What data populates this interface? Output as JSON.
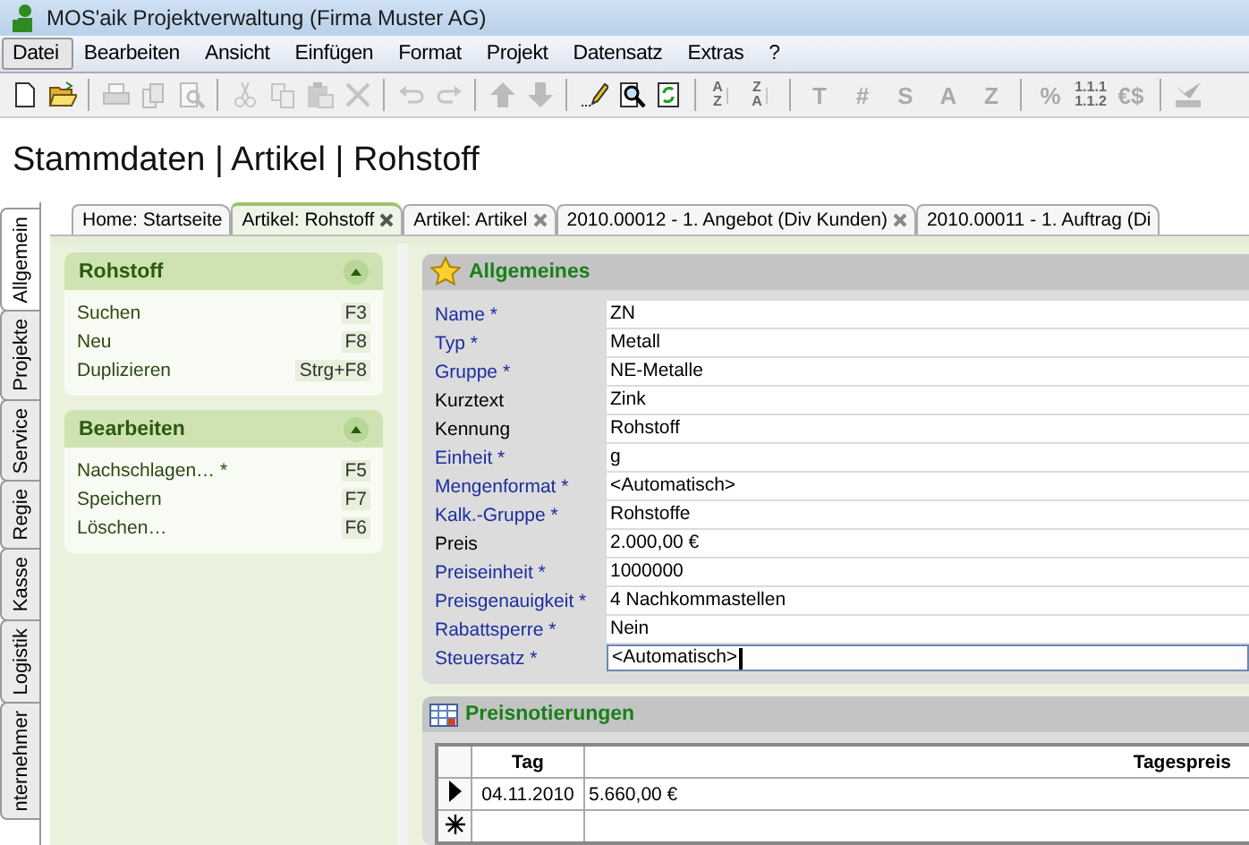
{
  "window": {
    "title": "MOS'aik Projektverwaltung (Firma Muster AG)"
  },
  "menu": [
    {
      "label": "Datei",
      "selected": true
    },
    {
      "label": "Bearbeiten",
      "selected": false
    },
    {
      "label": "Ansicht",
      "selected": false
    },
    {
      "label": "Einfügen",
      "selected": false
    },
    {
      "label": "Format",
      "selected": false
    },
    {
      "label": "Projekt",
      "selected": false
    },
    {
      "label": "Datensatz",
      "selected": false
    },
    {
      "label": "Extras",
      "selected": false
    },
    {
      "label": "?",
      "selected": false
    }
  ],
  "toolbar": [
    [
      {
        "kind": "icon",
        "disabled": false
      },
      {
        "kind": "icon",
        "disabled": false
      }
    ],
    [
      {
        "kind": "icon",
        "disabled": true
      },
      {
        "kind": "icon",
        "disabled": true
      },
      {
        "kind": "icon",
        "disabled": true
      }
    ],
    [
      {
        "kind": "icon",
        "disabled": true
      },
      {
        "kind": "icon",
        "disabled": true
      },
      {
        "kind": "icon",
        "disabled": true
      },
      {
        "kind": "icon",
        "disabled": true
      }
    ],
    [
      {
        "kind": "icon",
        "disabled": true
      },
      {
        "kind": "icon",
        "disabled": true
      }
    ],
    [
      {
        "kind": "icon",
        "disabled": true
      },
      {
        "kind": "icon",
        "disabled": true
      }
    ],
    [
      {
        "kind": "icon",
        "disabled": false
      },
      {
        "kind": "icon",
        "disabled": false
      },
      {
        "kind": "icon",
        "disabled": false
      }
    ],
    [
      {
        "kind": "sort",
        "lines": [
          "A",
          "Z"
        ],
        "disabled": true
      },
      {
        "kind": "sort",
        "lines": [
          "Z",
          "A"
        ],
        "disabled": true
      }
    ],
    [
      {
        "kind": "glyph",
        "label": "T",
        "disabled": true
      },
      {
        "kind": "glyph",
        "label": "#",
        "disabled": true
      },
      {
        "kind": "glyph",
        "label": "S",
        "disabled": true
      },
      {
        "kind": "glyph",
        "label": "A",
        "disabled": true
      },
      {
        "kind": "glyph",
        "label": "Z",
        "disabled": true
      }
    ],
    [
      {
        "kind": "glyph",
        "label": "%",
        "disabled": true
      },
      {
        "kind": "stack",
        "lines": [
          "1.1.1",
          "1.1.2"
        ],
        "disabled": true
      },
      {
        "kind": "glyph",
        "label": "€$",
        "disabled": true
      }
    ],
    [
      {
        "kind": "icon",
        "disabled": true
      }
    ]
  ],
  "heading": "Stammdaten | Artikel | Rohstoff",
  "side_tabs": [
    {
      "label": "Allgemein",
      "selected": true
    },
    {
      "label": "Projekte",
      "selected": false
    },
    {
      "label": "Service",
      "selected": false
    },
    {
      "label": "Regie",
      "selected": false
    },
    {
      "label": "Kasse",
      "selected": false
    },
    {
      "label": "Logistik",
      "selected": false
    },
    {
      "label": "nternehmer",
      "selected": false
    }
  ],
  "doc_tabs": [
    {
      "label": "Home: Startseite",
      "selected": false,
      "closable": false
    },
    {
      "label": "Artikel: Rohstoff",
      "selected": true,
      "closable": true
    },
    {
      "label": "Artikel: Artikel",
      "selected": false,
      "closable": true
    },
    {
      "label": "2010.00012 - 1. Angebot (Div Kunden)",
      "selected": false,
      "closable": true
    },
    {
      "label": "2010.00011 - 1. Auftrag (Di",
      "selected": false,
      "closable": false
    }
  ],
  "task_groups": [
    {
      "title": "Rohstoff",
      "expanded": true,
      "items": [
        {
          "label": "Suchen",
          "shortcut": "F3"
        },
        {
          "label": "Neu",
          "shortcut": "F8"
        },
        {
          "label": "Duplizieren",
          "shortcut": "Strg+F8"
        }
      ]
    },
    {
      "title": "Bearbeiten",
      "expanded": true,
      "items": [
        {
          "label": "Nachschlagen… *",
          "shortcut": "F5"
        },
        {
          "label": "Speichern",
          "shortcut": "F7"
        },
        {
          "label": "Löschen…",
          "shortcut": "F6"
        }
      ]
    }
  ],
  "general": {
    "title": "Allgemeines",
    "fields": [
      {
        "label": "Name *",
        "required": true,
        "value": "ZN",
        "focused": false
      },
      {
        "label": "Typ *",
        "required": true,
        "value": "Metall",
        "focused": false
      },
      {
        "label": "Gruppe *",
        "required": true,
        "value": "NE-Metalle",
        "focused": false
      },
      {
        "label": "Kurztext",
        "required": false,
        "value": "Zink",
        "focused": false
      },
      {
        "label": "Kennung",
        "required": false,
        "value": "Rohstoff",
        "focused": false
      },
      {
        "label": "Einheit *",
        "required": true,
        "value": "g",
        "focused": false
      },
      {
        "label": "Mengenformat *",
        "required": true,
        "value": "<Automatisch>",
        "focused": false
      },
      {
        "label": "Kalk.-Gruppe *",
        "required": true,
        "value": "Rohstoffe",
        "focused": false
      },
      {
        "label": "Preis",
        "required": false,
        "value": "2.000,00 €",
        "focused": false
      },
      {
        "label": "Preiseinheit *",
        "required": true,
        "value": "1000000",
        "focused": false
      },
      {
        "label": "Preisgenauigkeit *",
        "required": true,
        "value": "4 Nachkommastellen",
        "focused": false
      },
      {
        "label": "Rabattsperre *",
        "required": true,
        "value": "Nein",
        "focused": false
      },
      {
        "label": "Steuersatz *",
        "required": true,
        "value": "<Automatisch>",
        "focused": true
      }
    ]
  },
  "prices": {
    "title": "Preisnotierungen",
    "columns": [
      "Tag",
      "Tagespreis"
    ],
    "rows": [
      {
        "selected": true,
        "new": false,
        "cells": [
          "04.11.2010",
          "5.660,00 €"
        ]
      },
      {
        "selected": false,
        "new": true
      }
    ]
  }
}
